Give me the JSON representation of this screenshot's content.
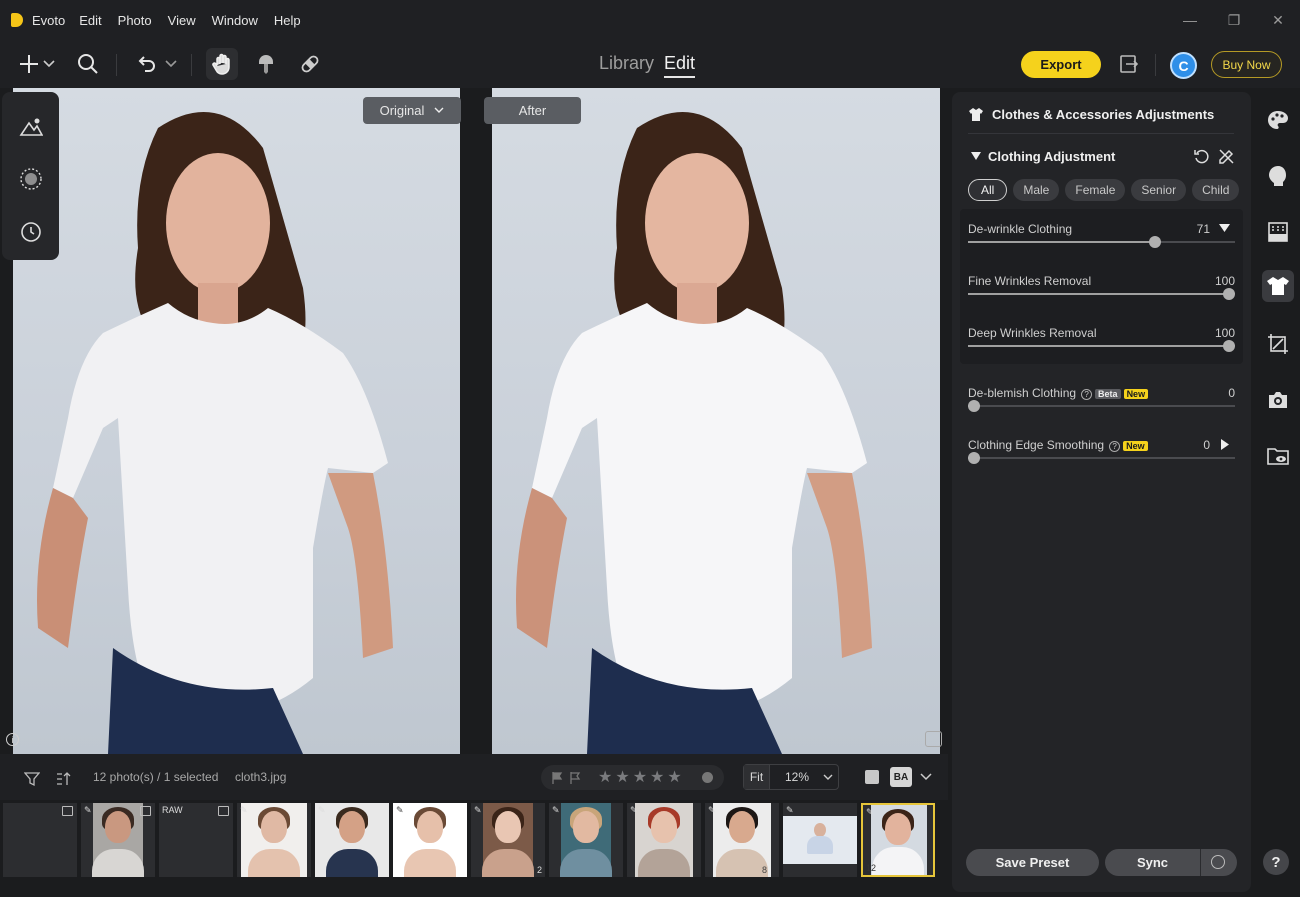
{
  "app": {
    "name": "Evoto"
  },
  "menu": [
    "Edit",
    "Photo",
    "View",
    "Window",
    "Help"
  ],
  "mode_tabs": {
    "library": "Library",
    "edit": "Edit"
  },
  "toolbar": {
    "export": "Export",
    "avatar_letter": "C",
    "buy_now": "Buy Now"
  },
  "compare": {
    "original": "Original",
    "after": "After"
  },
  "filmbar": {
    "count": "12 photo(s) / 1 selected",
    "filename": "cloth3.jpg",
    "fit": "Fit",
    "zoom": "12%",
    "stars": "★★★★★"
  },
  "thumbnails": {
    "raw_badge": "RAW",
    "badge_2": "2",
    "badge_8": "8",
    "badge_12": "12"
  },
  "panel": {
    "title": "Clothes & Accessories Adjustments",
    "section": "Clothing Adjustment",
    "filters": [
      "All",
      "Male",
      "Female",
      "Senior",
      "Child"
    ],
    "sliders": [
      {
        "label": "De-wrinkle Clothing",
        "value": "71",
        "level": 71
      },
      {
        "label": "Fine Wrinkles Removal",
        "value": "100",
        "level": 100
      },
      {
        "label": "Deep Wrinkles Removal",
        "value": "100",
        "level": 100
      },
      {
        "label": "De-blemish Clothing",
        "value": "0",
        "level": 0,
        "beta": "Beta",
        "new": "New"
      },
      {
        "label": "Clothing Edge Smoothing",
        "value": "0",
        "level": 0,
        "new": "New"
      }
    ],
    "save_preset": "Save Preset",
    "sync": "Sync"
  },
  "help": "?",
  "icons": [
    "add-icon",
    "search-icon",
    "undo-icon",
    "hand-icon",
    "brush-icon",
    "bandage-icon",
    "export-panel-icon",
    "palette-icon",
    "face-icon",
    "texture-icon",
    "shirt-icon",
    "crop-icon",
    "camera-icon",
    "folder-eye-icon",
    "history-icon"
  ]
}
